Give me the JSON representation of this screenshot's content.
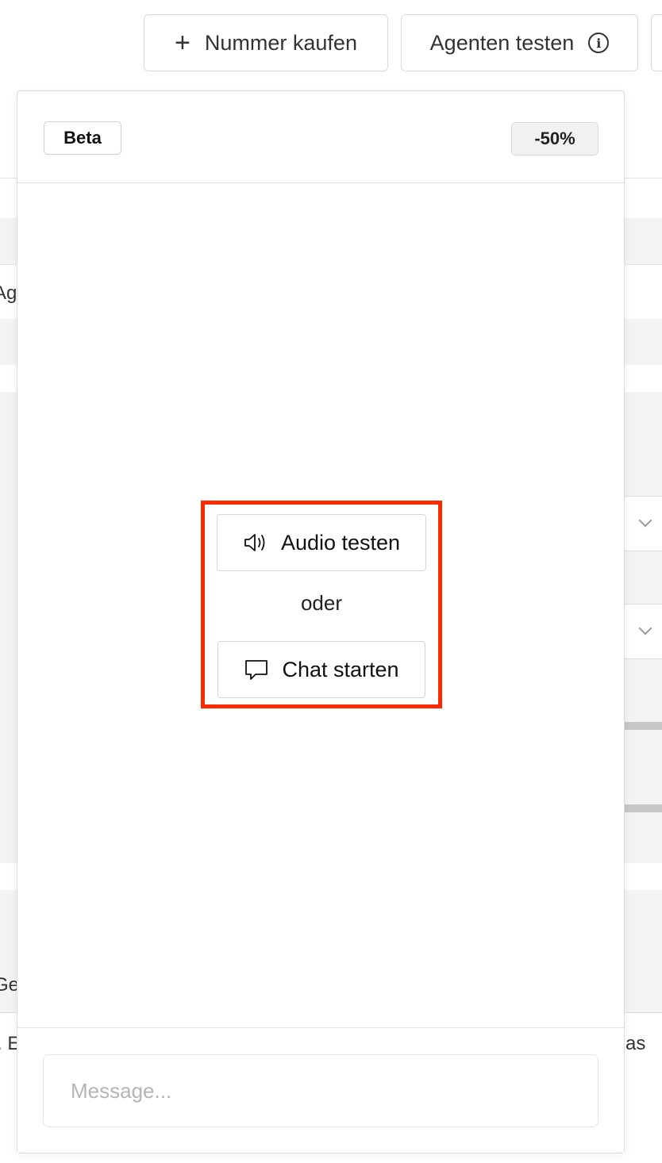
{
  "toolbar": {
    "buy_number_label": "Nummer kaufen",
    "test_agent_label": "Agenten testen",
    "info_glyph": "i"
  },
  "background": {
    "fragment_1": "Ag",
    "fragment_2": "Ge",
    "fragment_3": ". E",
    "fragment_4": "as"
  },
  "panel": {
    "beta_badge": "Beta",
    "discount_badge": "-50%",
    "audio_button_label": "Audio testen",
    "or_text": "oder",
    "chat_button_label": "Chat starten",
    "message_placeholder": "Message...",
    "highlight_color": "#ff2a00"
  },
  "icons": {
    "plus": "plus-icon",
    "info": "info-icon",
    "audio": "speaker-icon",
    "chat": "chat-bubble-icon"
  }
}
